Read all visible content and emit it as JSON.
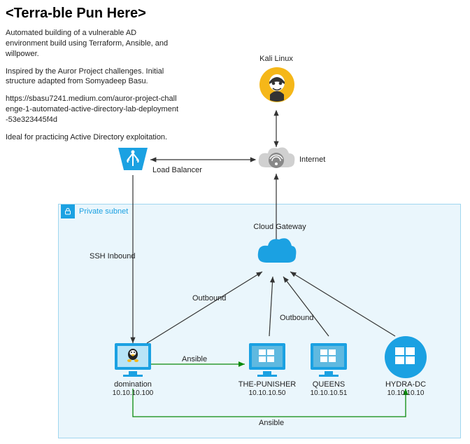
{
  "title": "<Terra-ble Pun Here>",
  "description": {
    "p1": "Automated building of a vulnerable AD environment build using Terraform, Ansible, and willpower.",
    "p2": "Inspired by the Auror Project challenges. Initial structure adapted from Somyadeep Basu.",
    "p3": "https://sbasu7241.medium.com/auror-project-challenge-1-automated-active-directory-lab-deployment-53e323445f4d",
    "p4": "Ideal for practicing Active Directory exploitation."
  },
  "nodes": {
    "kali": {
      "label": "Kali Linux"
    },
    "internet": {
      "label": "Internet"
    },
    "loadbalancer": {
      "label": "Load Balancer"
    },
    "subnet": {
      "label": "Private subnet"
    },
    "gateway": {
      "label": "Cloud Gateway"
    },
    "domination": {
      "name": "domination",
      "ip": "10.10.10.100"
    },
    "punisher": {
      "name": "THE-PUNISHER",
      "ip": "10.10.10.50"
    },
    "queens": {
      "name": "QUEENS",
      "ip": "10.10.10.51"
    },
    "hydra": {
      "name": "HYDRA-DC",
      "ip": "10.10.10.10"
    }
  },
  "edges": {
    "ssh_inbound": "SSH Inbound",
    "outbound1": "Outbound",
    "outbound2": "Outbound",
    "ansible1": "Ansible",
    "ansible2": "Ansible"
  }
}
